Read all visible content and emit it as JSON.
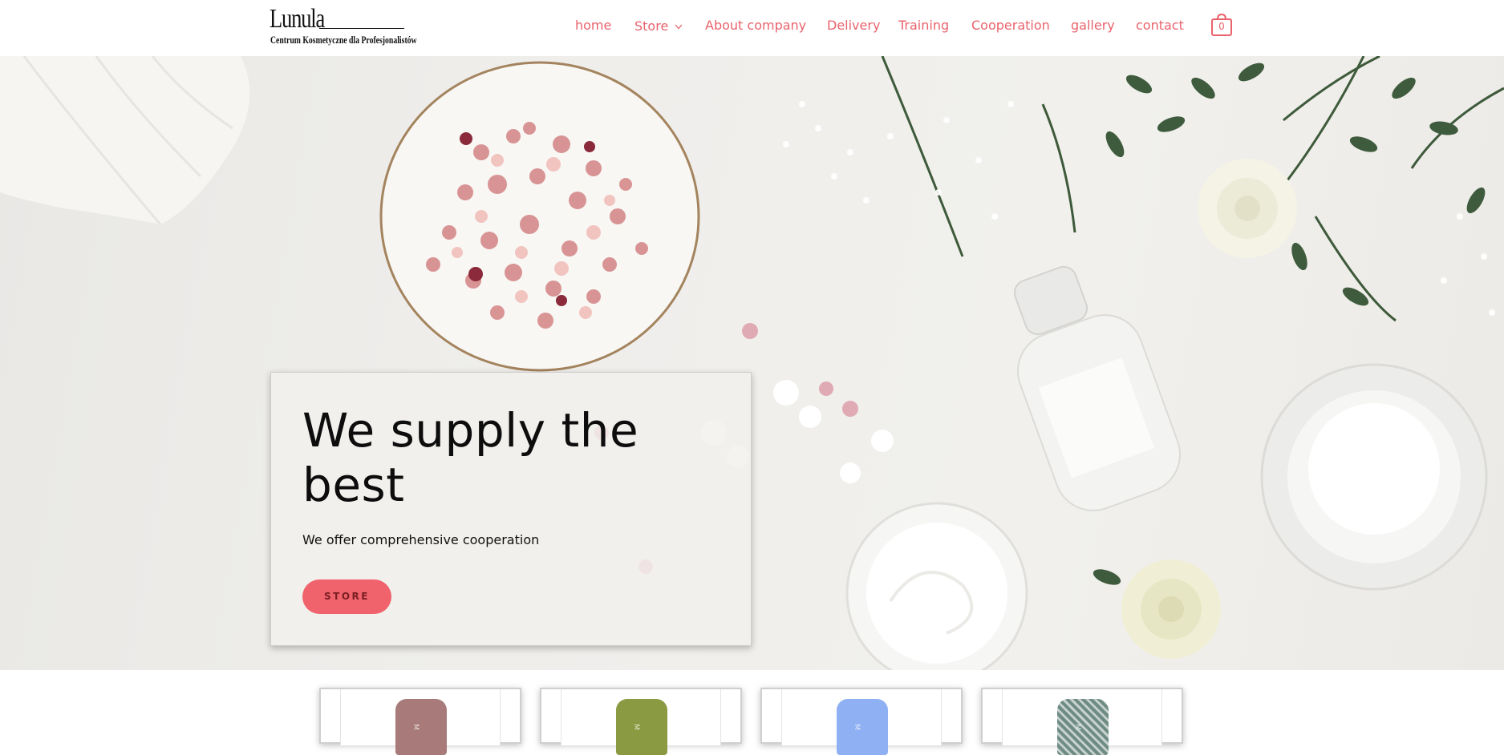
{
  "brand": {
    "name": "Lunula",
    "tagline": "Centrum Kosmetyczne dla Profesjonalistów"
  },
  "nav": {
    "items": [
      {
        "label": "home"
      },
      {
        "label": "Store",
        "has_dropdown": true
      },
      {
        "label": "About company"
      },
      {
        "label": "Delivery"
      },
      {
        "label": "Training"
      },
      {
        "label": "Cooperation"
      },
      {
        "label": "gallery"
      },
      {
        "label": "contact"
      }
    ],
    "cart_count": "0",
    "cart_icon": "shopping-bag-icon",
    "dropdown_icon": "chevron-down-icon"
  },
  "hero": {
    "title": "We supply the best",
    "subtitle": "We offer comprehensive cooperation",
    "button_label": "STORE"
  },
  "products": [
    {
      "bottle_color": "#a87a7a",
      "bottle_letter": "M"
    },
    {
      "bottle_color": "#8a9a42",
      "bottle_letter": "M"
    },
    {
      "bottle_color": "#8fb0f2",
      "bottle_letter": "M"
    },
    {
      "bottle_color": "#6f8c84",
      "bottle_letter": "M"
    }
  ],
  "colors": {
    "accent": "#e9636c",
    "button": "#f0636c",
    "text": "#0d0d0d",
    "background": "#ffffff"
  }
}
